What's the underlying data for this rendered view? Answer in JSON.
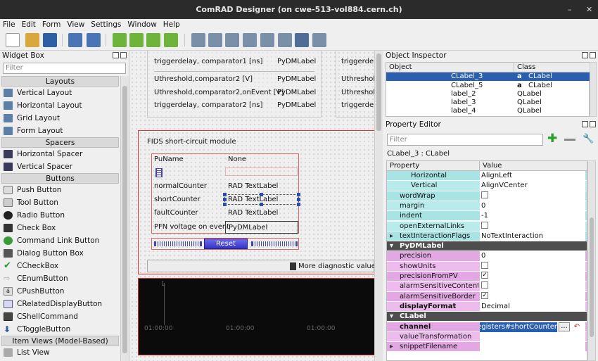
{
  "window": {
    "title": "ComRAD Designer (on cwe-513-vol884.cern.ch)",
    "minimize": "–",
    "close": "✕"
  },
  "menu": [
    "File",
    "Edit",
    "Form",
    "View",
    "Settings",
    "Window",
    "Help"
  ],
  "widget_box": {
    "title": "Widget Box",
    "filter_placeholder": "Filter",
    "categories": {
      "layouts": "Layouts",
      "spacers": "Spacers",
      "buttons": "Buttons",
      "item_views": "Item Views (Model-Based)"
    },
    "layouts": [
      "Vertical Layout",
      "Horizontal Layout",
      "Grid Layout",
      "Form Layout"
    ],
    "spacers": [
      "Horizontal Spacer",
      "Vertical Spacer"
    ],
    "buttons": [
      "Push Button",
      "Tool Button",
      "Radio Button",
      "Check Box",
      "Command Link Button",
      "Dialog Button Box",
      "CCheckBox",
      "CEnumButton",
      "CPushButton",
      "CRelatedDisplayButton",
      "CShellCommand",
      "CToggleButton"
    ],
    "partial": "List View"
  },
  "canvas": {
    "top_rows": [
      {
        "left": "triggerdelay, comparator1 [ns]",
        "right": "PyDMLabel"
      },
      {
        "left": "Uthreshold,comparator2 [V]",
        "right": "PyDMLabel"
      },
      {
        "left": "Uthreshold,comparator2,onEvent [V]",
        "right": "PyDMLabel"
      },
      {
        "left": "triggerdelay, comparator2 [ns]",
        "right": "PyDMLabel"
      }
    ],
    "right_col": [
      "triggerdel",
      "Uthreshol",
      "Uthreshol",
      "triggerdel"
    ],
    "module_title": "FIDS short-circuit module",
    "module_rows": [
      {
        "left": "PuName",
        "right": "None"
      },
      {
        "left": "normalCounter",
        "right": "RAD TextLabel"
      },
      {
        "left": "shortCounter",
        "right": "RAD TextLabel"
      },
      {
        "left": "faultCounter",
        "right": "RAD TextLabel"
      },
      {
        "left": "PFN voltage on event",
        "right": "PyDMLabel"
      }
    ],
    "reset_label": "Reset",
    "more_label": "More diagnostic values",
    "plot_ticks": [
      "01:00:00",
      "01:00:00",
      "01:00:00"
    ]
  },
  "object_inspector": {
    "title": "Object Inspector",
    "columns": [
      "Object",
      "Class"
    ],
    "rows": [
      {
        "object": "CLabel_3",
        "class": "CLabel",
        "selected": true
      },
      {
        "object": "CLabel_5",
        "class": "CLabel"
      },
      {
        "object": "label_2",
        "class": "QLabel"
      },
      {
        "object": "label_3",
        "class": "QLabel"
      },
      {
        "object": "label_4",
        "class": "QLabel"
      }
    ]
  },
  "property_editor": {
    "title": "Property Editor",
    "filter_placeholder": "Filter",
    "context": "CLabel_3 : CLabel",
    "columns": [
      "Property",
      "Value"
    ],
    "rows": [
      {
        "k": "Horizontal",
        "v": "AlignLeft",
        "c": "#a8e4e4",
        "indent": 2
      },
      {
        "k": "Vertical",
        "v": "AlignVCenter",
        "c": "#b8ecec",
        "indent": 2
      },
      {
        "k": "wordWrap",
        "v": "",
        "cb": "off",
        "c": "#a8e4e4"
      },
      {
        "k": "margin",
        "v": "0",
        "c": "#b8ecec"
      },
      {
        "k": "indent",
        "v": "-1",
        "c": "#a8e4e4"
      },
      {
        "k": "openExternalLinks",
        "v": "",
        "cb": "off",
        "c": "#b8ecec"
      },
      {
        "k": "textInteractionFlags",
        "v": "NoTextInteraction",
        "c": "#a8e4e4",
        "arrow": "▸"
      },
      {
        "k": "PyDMLabel",
        "v": "",
        "c": "#4e4e4e",
        "section": true
      },
      {
        "k": "precision",
        "v": "0",
        "c": "#e3a8e3"
      },
      {
        "k": "showUnits",
        "v": "",
        "cb": "off",
        "c": "#eebbee"
      },
      {
        "k": "precisionFromPV",
        "v": "",
        "cb": "on",
        "c": "#e3a8e3"
      },
      {
        "k": "alarmSensitiveContent",
        "v": "",
        "cb": "off",
        "c": "#eebbee"
      },
      {
        "k": "alarmSensitiveBorder",
        "v": "",
        "cb": "on",
        "c": "#e3a8e3"
      },
      {
        "k": "displayFormat",
        "v": "Decimal",
        "c": "#eebbee",
        "bold": true
      },
      {
        "k": "CLabel",
        "v": "",
        "c": "#4e4e4e",
        "section": true
      },
      {
        "k": "channel",
        "v": "rort/Registers#shortCounter",
        "c": "#e3a8e3",
        "bold": true,
        "editing": true
      },
      {
        "k": "valueTransformation",
        "v": "",
        "c": "#eebbee"
      },
      {
        "k": "snippetFilename",
        "v": "",
        "c": "#e3a8e3",
        "arrow": "▸"
      }
    ],
    "more_btn": "..."
  }
}
